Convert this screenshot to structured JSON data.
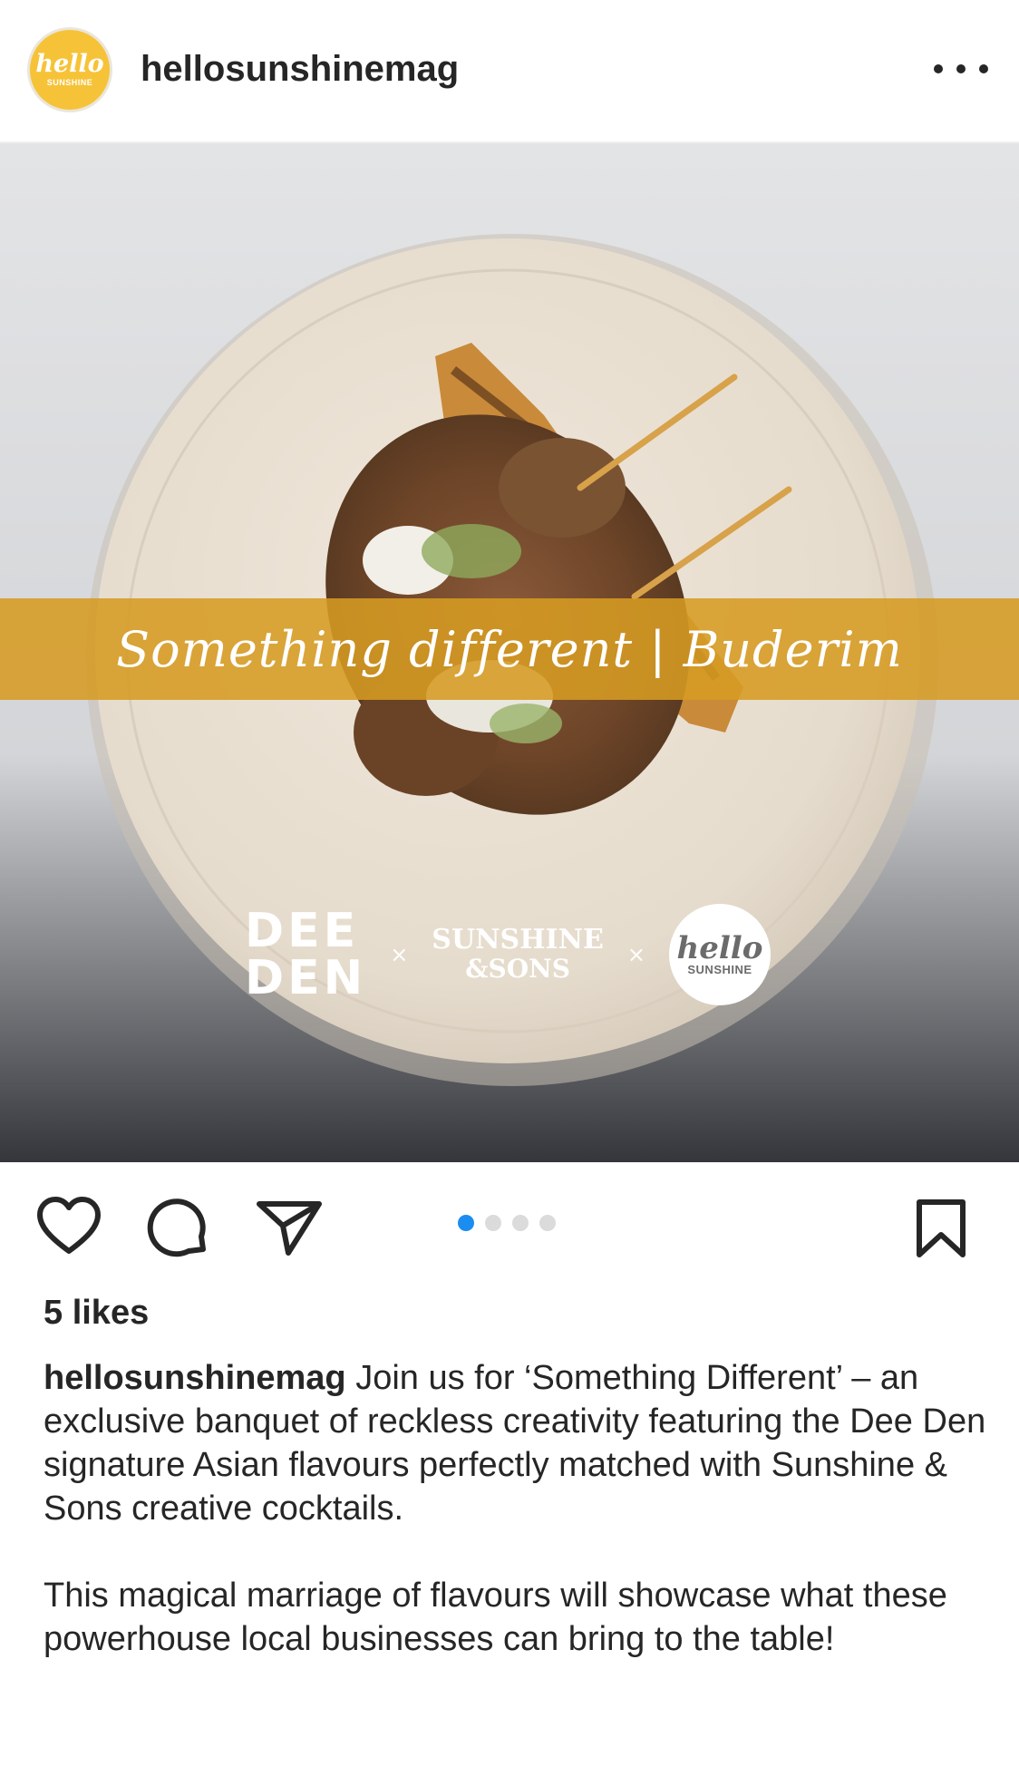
{
  "header": {
    "username": "hellosunshinemag",
    "avatar": {
      "line1": "hello",
      "line2": "SUNSHINE",
      "color": "#f6c338"
    }
  },
  "post_image": {
    "banner_text": "Something different | Buderim",
    "logos": {
      "dee_den_line1": "DEE",
      "dee_den_line2": "DEN",
      "separator": "×",
      "sons_line1": "SUNSHINE",
      "sons_line2": "&SONS",
      "hello_line1": "hello",
      "hello_line2": "SUNSHINE"
    },
    "banner_color": "#d69b22"
  },
  "actions": {
    "icons": [
      "heart-icon",
      "comment-icon",
      "share-icon",
      "bookmark-icon"
    ],
    "carousel": {
      "current": 1,
      "total": 4,
      "active_color": "#1c8df0"
    }
  },
  "likes": "5 likes",
  "caption": {
    "username": "hellosunshinemag",
    "paragraph1": "Join us for ‘Something Different’ – an exclusive banquet of reckless creativity featuring the Dee Den signature Asian flavours perfectly matched with Sunshine & Sons creative cocktails.",
    "paragraph2": "This magical marriage of flavours will showcase what these powerhouse local businesses can bring to the table!"
  }
}
